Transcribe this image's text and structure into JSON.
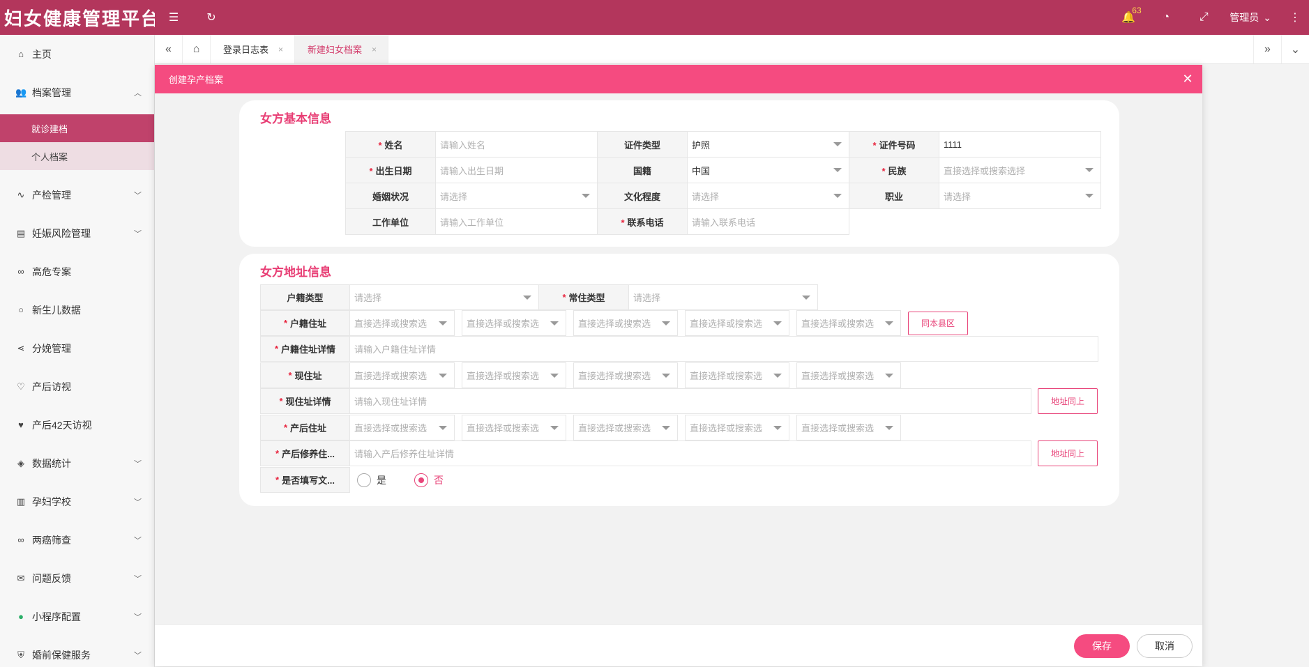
{
  "app": {
    "title": "妇女健康管理平台",
    "notification_count": "63",
    "user": "管理员"
  },
  "sidebar": {
    "items": [
      {
        "label": "主页",
        "icon": "home-icon"
      },
      {
        "label": "档案管理",
        "icon": "users-icon"
      },
      {
        "label": "产检管理",
        "icon": "pulse-icon"
      },
      {
        "label": "妊娠风险管理",
        "icon": "list-icon"
      },
      {
        "label": "高危专案",
        "icon": "link-icon"
      },
      {
        "label": "新生儿数据",
        "icon": "circle-icon"
      },
      {
        "label": "分娩管理",
        "icon": "share-icon"
      },
      {
        "label": "产后访视",
        "icon": "heart-outline-icon"
      },
      {
        "label": "产后42天访视",
        "icon": "heart-icon"
      },
      {
        "label": "数据统计",
        "icon": "layers-icon"
      },
      {
        "label": "孕妇学校",
        "icon": "book-icon"
      },
      {
        "label": "两癌筛查",
        "icon": "link-icon"
      },
      {
        "label": "问题反馈",
        "icon": "mail-icon"
      },
      {
        "label": "小程序配置",
        "icon": "wechat-icon"
      },
      {
        "label": "婚前保健服务",
        "icon": "shield-icon"
      }
    ],
    "subitems": [
      {
        "label": "就诊建档"
      },
      {
        "label": "个人档案"
      }
    ]
  },
  "tabs": [
    {
      "label": "登录日志表"
    },
    {
      "label": "新建妇女档案"
    }
  ],
  "modal": {
    "title": "创建孕产档案",
    "save": "保存",
    "cancel": "取消"
  },
  "basic": {
    "title": "女方基本信息",
    "name_label": "姓名",
    "name_ph": "请输入姓名",
    "idtype_label": "证件类型",
    "idtype_value": "护照",
    "idno_label": "证件号码",
    "idno_value": "1111",
    "birth_label": "出生日期",
    "birth_ph": "请输入出生日期",
    "nation_label": "国籍",
    "nation_value": "中国",
    "ethnic_label": "民族",
    "ethnic_ph": "直接选择或搜索选择",
    "marital_label": "婚姻状况",
    "marital_ph": "请选择",
    "edu_label": "文化程度",
    "edu_ph": "请选择",
    "job_label": "职业",
    "job_ph": "请选择",
    "work_label": "工作单位",
    "work_ph": "请输入工作单位",
    "phone_label": "联系电话",
    "phone_ph": "请输入联系电话"
  },
  "address": {
    "title": "女方地址信息",
    "hjtype_label": "户籍类型",
    "hjtype_ph": "请选择",
    "cztype_label": "常住类型",
    "cztype_ph": "请选择",
    "hj_label": "户籍住址",
    "hjdetail_label": "户籍住址详情",
    "hjdetail_ph": "请输入户籍住址详情",
    "cur_label": "现住址",
    "curdetail_label": "现住址详情",
    "curdetail_ph": "请输入现住址详情",
    "pp_label": "产后住址",
    "ppdetail_label": "产后修养住...",
    "ppdetail_ph": "请输入产后修养住址详情",
    "fill_label": "是否填写文...",
    "select_ph": "直接选择或搜索选",
    "same_county": "同本县区",
    "same_addr": "地址同上",
    "yes": "是",
    "no": "否"
  }
}
